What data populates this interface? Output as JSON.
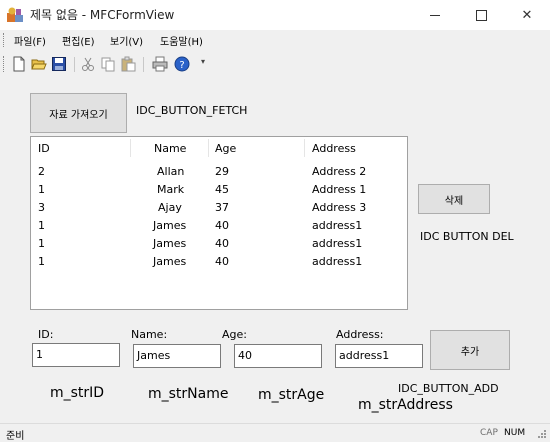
{
  "window": {
    "title": "제목 없음 - MFCFormView",
    "minimize_icon": "minimize-icon",
    "maximize_icon": "maximize-icon",
    "close_icon": "close-icon",
    "close_glyph": "✕"
  },
  "menu": {
    "items": [
      {
        "label": "파일(F)"
      },
      {
        "label": "편집(E)"
      },
      {
        "label": "보기(V)"
      },
      {
        "label": "도움말(H)"
      }
    ]
  },
  "toolbar": {
    "icons": [
      "new-file-icon",
      "open-folder-icon",
      "save-icon",
      "cut-icon",
      "copy-icon",
      "paste-icon",
      "print-icon",
      "help-icon"
    ],
    "more_glyph": "▾"
  },
  "form": {
    "fetch_button": "자료 가져오기",
    "fetch_id_label": "IDC_BUTTON_FETCH",
    "delete_button": "삭제",
    "delete_id_label": "IDC BUTTON DEL",
    "add_button": "추가",
    "add_id_label": "IDC_BUTTON_ADD",
    "list": {
      "columns": [
        "ID",
        "Name",
        "Age",
        "Address"
      ],
      "rows": [
        [
          "2",
          "Allan",
          "29",
          "Address 2"
        ],
        [
          "1",
          "Mark",
          "45",
          "Address 1"
        ],
        [
          "3",
          "Ajay",
          "37",
          "Address 3"
        ],
        [
          "1",
          "James",
          "40",
          "address1"
        ],
        [
          "1",
          "James",
          "40",
          "address1"
        ],
        [
          "1",
          "James",
          "40",
          "address1"
        ]
      ]
    },
    "fields": {
      "id": {
        "label": "ID:",
        "value": "1",
        "var": "m_strID"
      },
      "name": {
        "label": "Name:",
        "value": "James",
        "var": "m_strName"
      },
      "age": {
        "label": "Age:",
        "value": "40",
        "var": "m_strAge"
      },
      "address": {
        "label": "Address:",
        "value": "address1",
        "var": "m_strAddress"
      }
    }
  },
  "status": {
    "text": "준비",
    "cap": "CAP",
    "num": "NUM"
  }
}
